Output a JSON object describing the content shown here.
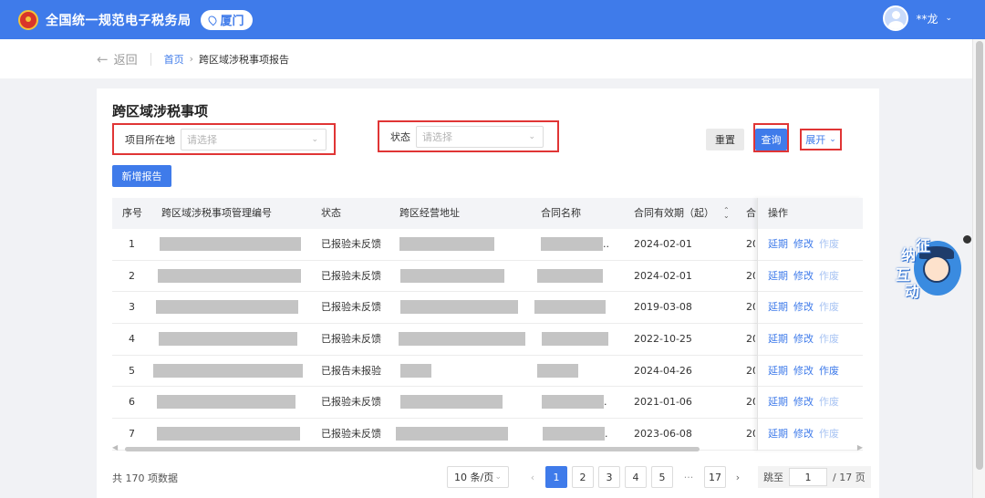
{
  "header": {
    "app_title": "全国统一规范电子税务局",
    "city": "厦门",
    "user_name": "**龙",
    "colors": {
      "header_bg": "#3f7bea",
      "primary": "#3f7bea",
      "highlight_border": "#e03535"
    }
  },
  "breadcrumb": {
    "back_label": "返回",
    "home": "首页",
    "current": "跨区域涉税事项报告"
  },
  "card": {
    "title": "跨区域涉税事项",
    "filters": {
      "location_label": "项目所在地",
      "location_placeholder": "请选择",
      "status_label": "状态",
      "status_placeholder": "请选择"
    },
    "buttons": {
      "reset": "重置",
      "query": "查询",
      "expand": "展开",
      "add_report": "新增报告"
    }
  },
  "table": {
    "columns": [
      "序号",
      "跨区域涉税事项管理编号",
      "状态",
      "跨区经营地址",
      "合同名称",
      "合同有效期（起）",
      "合",
      "操作"
    ],
    "rows": [
      {
        "index": "1",
        "status": "已报验未反馈",
        "contract_suffix": "..",
        "start": "2024-02-01",
        "next": "20",
        "ops": [
          "延期",
          "修改",
          "作废"
        ],
        "ops_enabled": [
          true,
          true,
          false
        ]
      },
      {
        "index": "2",
        "status": "已报验未反馈",
        "contract_suffix": "",
        "start": "2024-02-01",
        "next": "20",
        "ops": [
          "延期",
          "修改",
          "作废"
        ],
        "ops_enabled": [
          true,
          true,
          false
        ]
      },
      {
        "index": "3",
        "status": "已报验未反馈",
        "contract_suffix": "",
        "start": "2019-03-08",
        "next": "20",
        "ops": [
          "延期",
          "修改",
          "作废"
        ],
        "ops_enabled": [
          true,
          true,
          false
        ]
      },
      {
        "index": "4",
        "status": "已报验未反馈",
        "contract_suffix": "",
        "start": "2022-10-25",
        "next": "20",
        "ops": [
          "延期",
          "修改",
          "作废"
        ],
        "ops_enabled": [
          true,
          true,
          false
        ]
      },
      {
        "index": "5",
        "status": "已报告未报验",
        "contract_suffix": "",
        "start": "2024-04-26",
        "next": "20",
        "ops": [
          "延期",
          "修改",
          "作废"
        ],
        "ops_enabled": [
          true,
          true,
          true
        ]
      },
      {
        "index": "6",
        "status": "已报验未反馈",
        "contract_suffix": ".",
        "start": "2021-01-06",
        "next": "20",
        "ops": [
          "延期",
          "修改",
          "作废"
        ],
        "ops_enabled": [
          true,
          true,
          false
        ]
      },
      {
        "index": "7",
        "status": "已报验未反馈",
        "contract_suffix": ".",
        "start": "2023-06-08",
        "next": "20",
        "ops": [
          "延期",
          "修改",
          "作废"
        ],
        "ops_enabled": [
          true,
          true,
          false
        ]
      }
    ]
  },
  "pagination": {
    "total": "共 170 项数据",
    "page_size": "10 条/页",
    "pages": [
      "1",
      "2",
      "3",
      "4",
      "5"
    ],
    "current_page": "1",
    "ellipsis": "···",
    "last_page": "17",
    "jump_label": "跳至",
    "jump_value": "1",
    "page_suffix": "/ 17 页"
  },
  "mascot": {
    "chars": [
      "征",
      "纳",
      "互",
      "动"
    ]
  }
}
